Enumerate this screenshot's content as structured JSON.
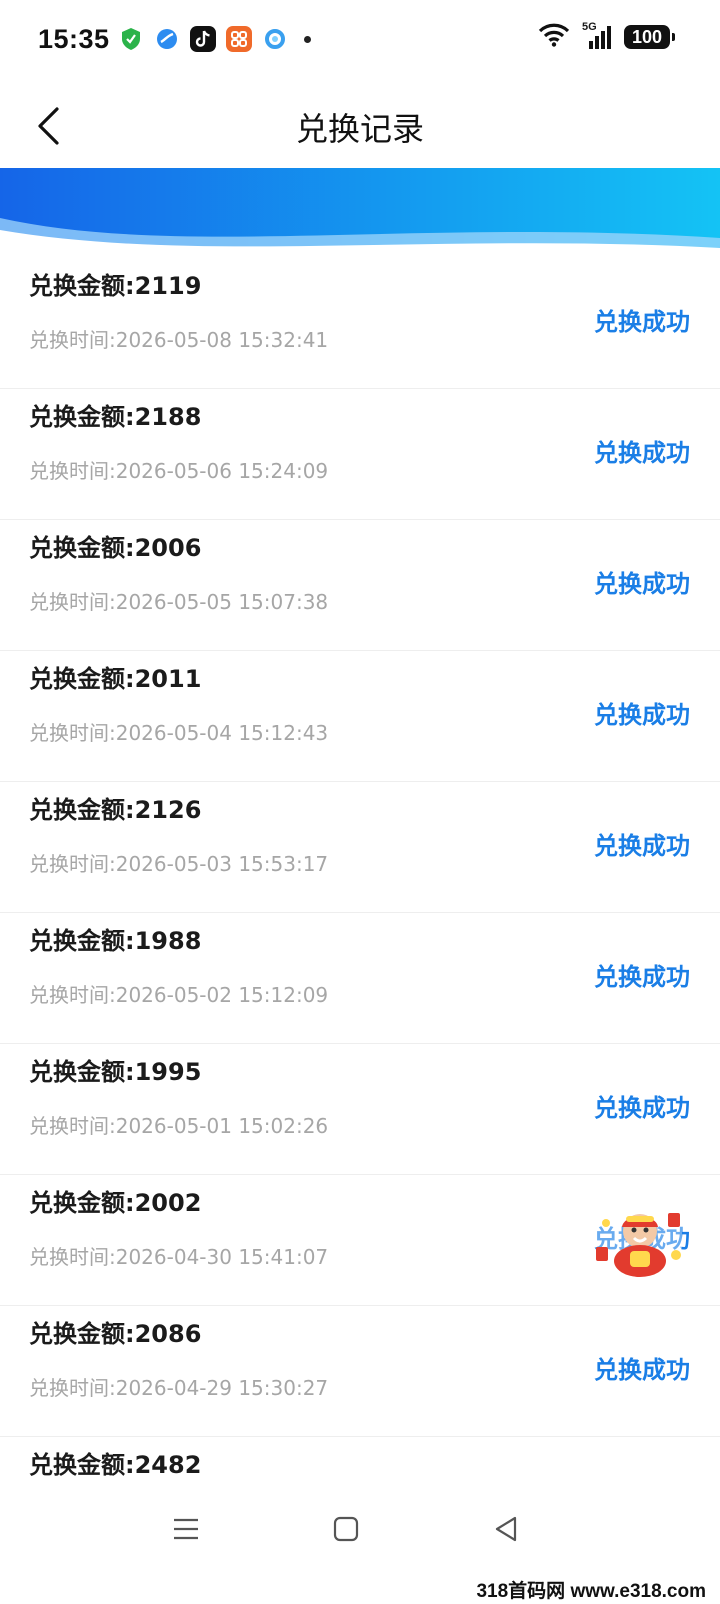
{
  "status_bar": {
    "time": "15:35",
    "network": "5G",
    "battery": "100",
    "app_icons": [
      "shield-icon",
      "browser-icon",
      "tiktok-icon",
      "app-grid-icon",
      "ring-icon"
    ]
  },
  "header": {
    "title": "兑换记录"
  },
  "records": [
    {
      "amount": "兑换金额:2119",
      "time": "兑换时间:2026-05-08 15:32:41",
      "status": "兑换成功"
    },
    {
      "amount": "兑换金额:2188",
      "time": "兑换时间:2026-05-06 15:24:09",
      "status": "兑换成功"
    },
    {
      "amount": "兑换金额:2006",
      "time": "兑换时间:2026-05-05 15:07:38",
      "status": "兑换成功"
    },
    {
      "amount": "兑换金额:2011",
      "time": "兑换时间:2026-05-04 15:12:43",
      "status": "兑换成功"
    },
    {
      "amount": "兑换金额:2126",
      "time": "兑换时间:2026-05-03 15:53:17",
      "status": "兑换成功"
    },
    {
      "amount": "兑换金额:1988",
      "time": "兑换时间:2026-05-02 15:12:09",
      "status": "兑换成功"
    },
    {
      "amount": "兑换金额:1995",
      "time": "兑换时间:2026-05-01 15:02:26",
      "status": "兑换成功"
    },
    {
      "amount": "兑换金额:2002",
      "time": "兑换时间:2026-04-30 15:41:07",
      "status": "兑换成功"
    },
    {
      "amount": "兑换金额:2086",
      "time": "兑换时间:2026-04-29 15:30:27",
      "status": "兑换成功"
    },
    {
      "amount": "兑换金额:2482",
      "time": "",
      "status": ""
    }
  ],
  "watermark": "318首码网 www.e318.com",
  "colors": {
    "status_success": "#1a7ee6",
    "banner_start": "#1565e8",
    "banner_end": "#14c3f5",
    "time_text": "#a6a6a6"
  }
}
